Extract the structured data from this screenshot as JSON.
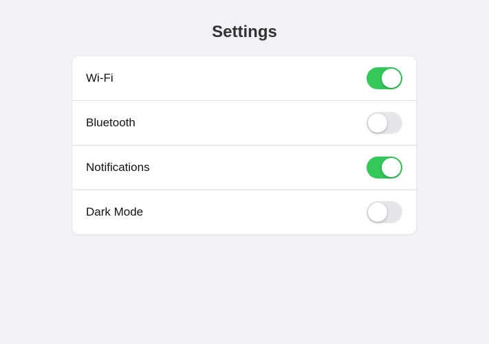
{
  "title": "Settings",
  "colors": {
    "background": "#f2f1f6",
    "toggle_on": "#34c759",
    "toggle_off": "#e5e5ea"
  },
  "settings": [
    {
      "label": "Wi-Fi",
      "enabled": true
    },
    {
      "label": "Bluetooth",
      "enabled": false
    },
    {
      "label": "Notifications",
      "enabled": true
    },
    {
      "label": "Dark Mode",
      "enabled": false
    }
  ]
}
